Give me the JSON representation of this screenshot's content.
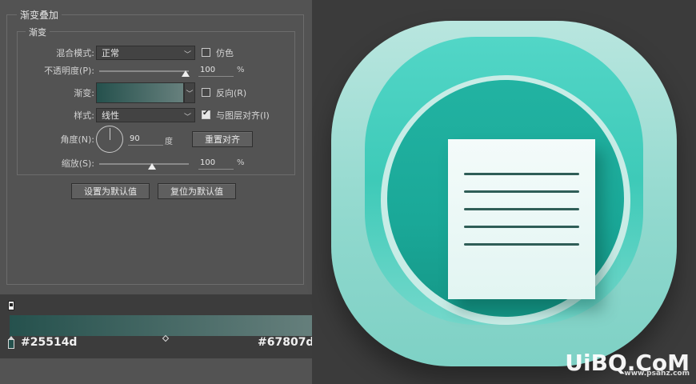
{
  "panel": {
    "group_title": "渐变叠加",
    "subgroup_title": "渐变",
    "blend_mode": {
      "label": "混合模式:",
      "value": "正常"
    },
    "dither": {
      "label": "仿色",
      "checked": false
    },
    "opacity": {
      "label": "不透明度(P):",
      "value": "100",
      "unit": "%",
      "level": 1.0
    },
    "gradient": {
      "label": "渐变:",
      "start_color": "#25514d",
      "end_color": "#67807d"
    },
    "reverse": {
      "label": "反向(R)",
      "checked": false
    },
    "style": {
      "label": "样式:",
      "value": "线性"
    },
    "align_with_layer": {
      "label": "与图层对齐(I)",
      "checked": true
    },
    "angle": {
      "label": "角度(N):",
      "value": "90",
      "unit": "度"
    },
    "reset_align_button": "重置对齐",
    "scale": {
      "label": "缩放(S):",
      "value": "100",
      "unit": "%",
      "level": 0.5
    },
    "make_default_button": "设置为默认值",
    "reset_default_button": "复位为默认值"
  },
  "gradient_bar": {
    "start_hex": "#25514d",
    "end_hex": "#67807d"
  },
  "artwork": {
    "outer_color": "#b9e6df",
    "circle_color": "#1aa898",
    "note_color": "#f4fbfa",
    "line_color": "#2f5e57",
    "watermark": "UiBQ.CoM",
    "watermark_sub": "www.psahz.com"
  }
}
